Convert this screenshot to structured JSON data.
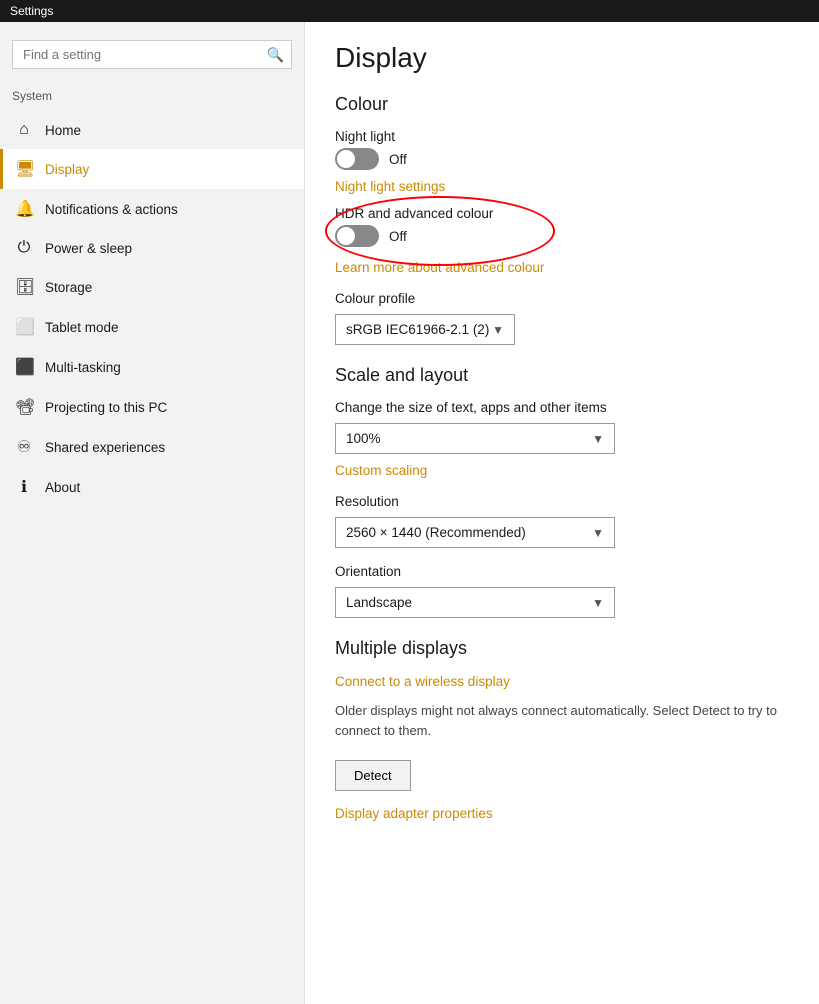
{
  "titleBar": {
    "label": "Settings"
  },
  "sidebar": {
    "searchPlaceholder": "Find a setting",
    "sectionLabel": "System",
    "items": [
      {
        "id": "home",
        "label": "Home",
        "icon": "⌂",
        "active": false
      },
      {
        "id": "display",
        "label": "Display",
        "icon": "🖥",
        "active": true
      },
      {
        "id": "notifications",
        "label": "Notifications & actions",
        "icon": "🔔",
        "active": false
      },
      {
        "id": "power",
        "label": "Power & sleep",
        "icon": "⏻",
        "active": false
      },
      {
        "id": "storage",
        "label": "Storage",
        "icon": "💾",
        "active": false
      },
      {
        "id": "tablet",
        "label": "Tablet mode",
        "icon": "⬜",
        "active": false
      },
      {
        "id": "multitasking",
        "label": "Multi-tasking",
        "icon": "⬛",
        "active": false
      },
      {
        "id": "projecting",
        "label": "Projecting to this PC",
        "icon": "📽",
        "active": false
      },
      {
        "id": "shared",
        "label": "Shared experiences",
        "icon": "♾",
        "active": false
      },
      {
        "id": "about",
        "label": "About",
        "icon": "ℹ",
        "active": false
      }
    ]
  },
  "main": {
    "pageTitle": "Display",
    "colour": {
      "sectionTitle": "Colour",
      "nightLight": {
        "label": "Night light",
        "state": "Off"
      },
      "nightLightSettings": "Night light settings",
      "hdr": {
        "label": "HDR and advanced colour",
        "state": "Off"
      },
      "learnMore": "Learn more about advanced colour",
      "colourProfile": {
        "label": "Colour profile",
        "value": "sRGB IEC61966-2.1 (2)"
      }
    },
    "scaleLayout": {
      "sectionTitle": "Scale and layout",
      "changeSize": {
        "label": "Change the size of text, apps and other items",
        "value": "100%"
      },
      "customScaling": "Custom scaling",
      "resolution": {
        "label": "Resolution",
        "value": "2560 × 1440 (Recommended)"
      },
      "orientation": {
        "label": "Orientation",
        "value": "Landscape"
      }
    },
    "multipleDisplays": {
      "sectionTitle": "Multiple displays",
      "connectWireless": "Connect to a wireless display",
      "description": "Older displays might not always connect automatically. Select Detect to try to connect to them.",
      "detectButton": "Detect",
      "adapterProperties": "Display adapter properties"
    }
  }
}
